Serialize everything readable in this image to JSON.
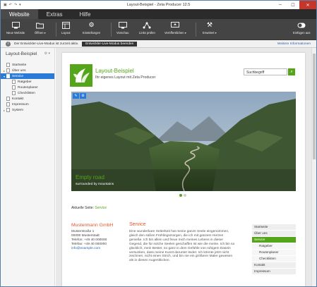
{
  "window": {
    "title": "Layout-Beispiel - Zeta Producer 12.5"
  },
  "tabs": [
    {
      "label": "Website"
    },
    {
      "label": "Extras"
    },
    {
      "label": "Hilfe"
    }
  ],
  "ribbon": {
    "buttons": [
      {
        "label": "Neue Website",
        "icon": "new-website-icon"
      },
      {
        "label": "Öffnen ▾",
        "icon": "open-folder-icon"
      },
      {
        "label": "Layout",
        "icon": "layout-icon"
      },
      {
        "label": "Einstellungen",
        "icon": "settings-icon"
      },
      {
        "label": "Vorschau",
        "icon": "preview-icon"
      },
      {
        "label": "Links prüfen",
        "icon": "links-icon"
      },
      {
        "label": "Veröffentlichen ▾",
        "icon": "publish-icon"
      },
      {
        "label": "Erweitert ▾",
        "icon": "advanced-icon"
      },
      {
        "label": "Einfügen aus",
        "icon": "toggle-icon"
      }
    ]
  },
  "infobar": {
    "message": "Der Entwickler-Live-Modus ist zurzeit aktiv.",
    "button": "Entwickler-Live-Modus beenden",
    "more_link": "Weitere Informationen"
  },
  "sidebar": {
    "title": "Layout-Beispiel",
    "tools": "⚙ ▾",
    "tree": [
      {
        "label": "Startseite",
        "level": 0,
        "arrow": "",
        "selected": false
      },
      {
        "label": "Über uns",
        "level": 0,
        "arrow": "▸",
        "selected": false
      },
      {
        "label": "Service",
        "level": 0,
        "arrow": "▾",
        "selected": true
      },
      {
        "label": "Ratgeber",
        "level": 1,
        "arrow": "",
        "selected": false
      },
      {
        "label": "Routenplaner",
        "level": 1,
        "arrow": "",
        "selected": false
      },
      {
        "label": "Checklisten",
        "level": 1,
        "arrow": "",
        "selected": false
      },
      {
        "label": "Kontakt",
        "level": 0,
        "arrow": "",
        "selected": false
      },
      {
        "label": "Impressum",
        "level": 0,
        "arrow": "",
        "selected": false
      },
      {
        "label": "System",
        "level": 0,
        "arrow": "▸",
        "selected": false
      }
    ]
  },
  "site": {
    "title": "Layout-Beispiel",
    "subtitle": "Ihr eigenes Layout mit Zeta Producer",
    "search_placeholder": "Suchbegriff",
    "hero_caption": "Empty road",
    "hero_subcaption": "surrounded by mountains",
    "breadcrumb_prefix": "Aktuelle Seite: ",
    "breadcrumb_current": "Service",
    "company": "Mustermann GmbH",
    "address": [
      "Musterstraße 1",
      "00000 Musterstadt",
      "Telefon: +49 40 000000",
      "Telefax: +49 40 000000"
    ],
    "email": "info@example.com",
    "service_heading": "Service",
    "service_text": "Eine wunderbare Heiterkeit hat meine ganze Seele eingenommen, gleich den süßen Frühlingsmorgen, die ich mit ganzem Herzen genieße. Ich bin allein und freue mich meines Lebens in dieser Gegend, die für solche Seelen geschaffen ist wie die meine. Ich bin so glücklich, mein Bester, so ganz in dem Gefühle von ruhigem Dasein versunken, dass meine Kunst darunter leidet. Ich könnte jetzt nicht zeichnen, nicht einen Strich, und bin nie ein größerer Maler gewesen als in diesen Augenblicken.",
    "subnav": [
      {
        "label": "Startseite",
        "active": false,
        "sub": false
      },
      {
        "label": "Über uns",
        "active": false,
        "sub": false
      },
      {
        "label": "Service",
        "active": true,
        "sub": false
      },
      {
        "label": "Ratgeber",
        "active": false,
        "sub": true
      },
      {
        "label": "Routenplaner",
        "active": false,
        "sub": true
      },
      {
        "label": "Checklisten",
        "active": false,
        "sub": true
      },
      {
        "label": "Kontakt",
        "active": false,
        "sub": false
      },
      {
        "label": "Impressum",
        "active": false,
        "sub": false
      }
    ]
  },
  "colors": {
    "accent": "#55a51b",
    "selection": "#2a7ad8",
    "heading": "#e8542a"
  }
}
